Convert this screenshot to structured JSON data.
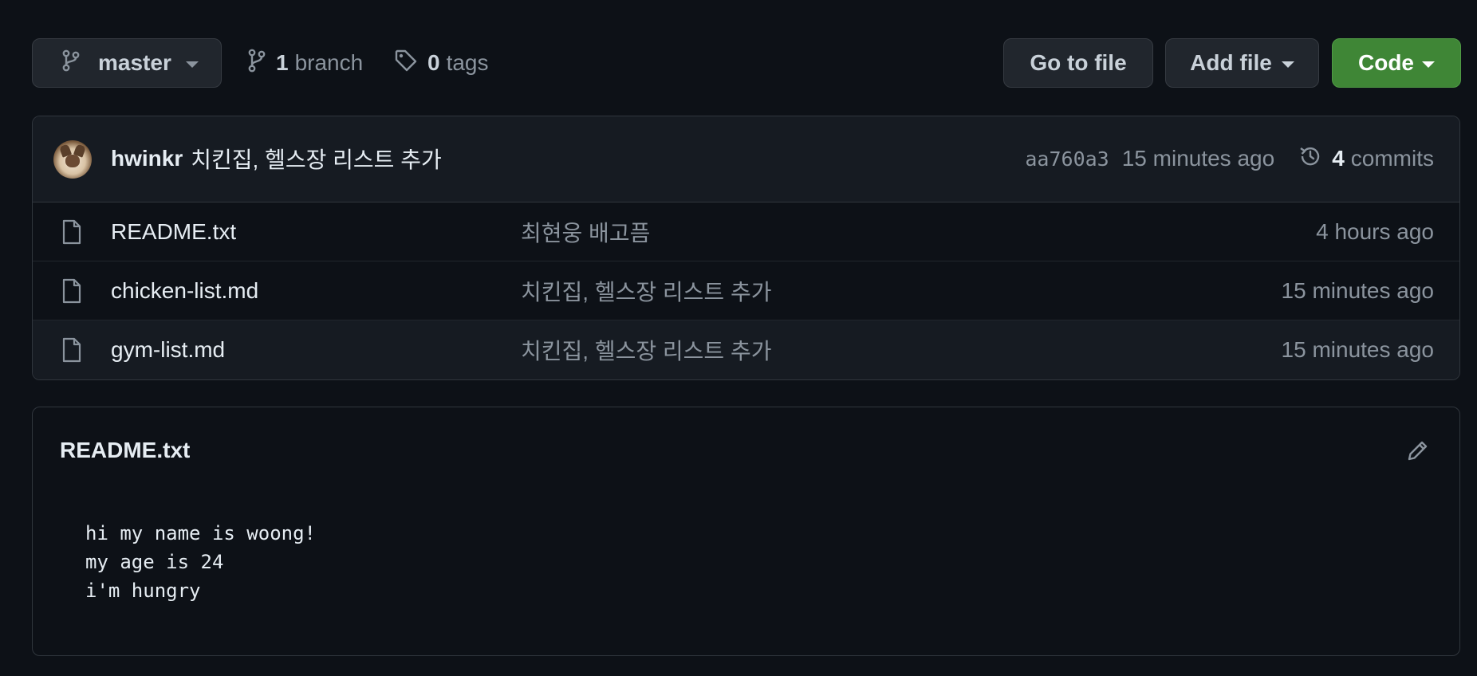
{
  "toolbar": {
    "branch_name": "master",
    "branch_count": "1",
    "branch_label": "branch",
    "tag_count": "0",
    "tag_label": "tags",
    "goto_file": "Go to file",
    "add_file": "Add file",
    "code": "Code"
  },
  "latest_commit": {
    "author": "hwinkr",
    "message": "치킨집, 헬스장 리스트 추가",
    "sha": "aa760a3",
    "time": "15 minutes ago",
    "commit_count": "4",
    "commit_label": "commits"
  },
  "files": [
    {
      "name": "README.txt",
      "message": "최현웅 배고픔",
      "age": "4 hours ago"
    },
    {
      "name": "chicken-list.md",
      "message": "치킨집, 헬스장 리스트 추가",
      "age": "15 minutes ago"
    },
    {
      "name": "gym-list.md",
      "message": "치킨집, 헬스장 리스트 추가",
      "age": "15 minutes ago"
    }
  ],
  "readme": {
    "title": "README.txt",
    "lines": [
      "hi my name is woong!",
      "my age is 24",
      "i'm hungry"
    ]
  },
  "colors": {
    "background": "#0d1117",
    "code_button": "#3f8636",
    "border": "#30363d"
  },
  "icons": {
    "branch": "git-branch-icon",
    "tag": "tag-icon",
    "history": "history-icon",
    "file": "file-icon",
    "edit": "pencil-icon"
  }
}
